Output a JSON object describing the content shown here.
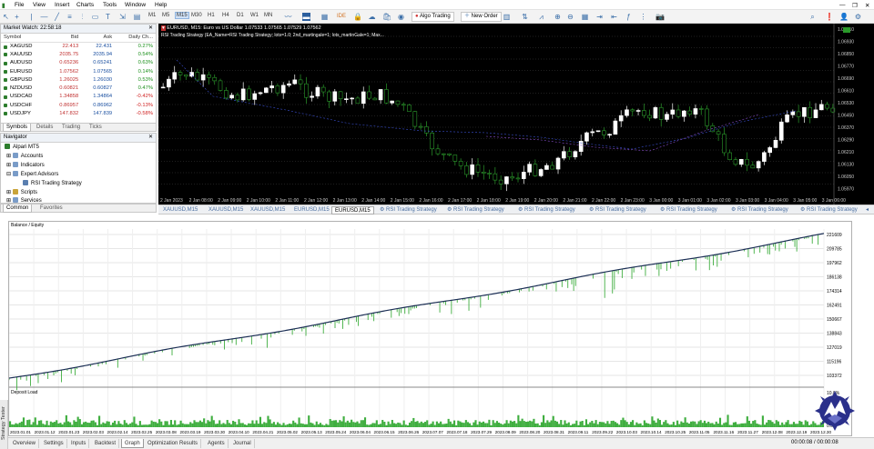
{
  "menu": [
    "File",
    "View",
    "Insert",
    "Charts",
    "Tools",
    "Window",
    "Help"
  ],
  "toolbar": {
    "timeframes": [
      "M1",
      "M5",
      "M15",
      "M30",
      "H1",
      "H4",
      "D1",
      "W1",
      "MN"
    ],
    "selected_tf": "M15",
    "algo_trading": "Algo Trading",
    "new_order": "New Order"
  },
  "market_watch": {
    "title": "Market Watch: 22:58:18",
    "columns": [
      "Symbol",
      "Bid",
      "Ask",
      "Daily Ch..."
    ],
    "rows": [
      {
        "symbol": "XAGUSD",
        "bid": "22.413",
        "ask": "22.431",
        "change": "0.27%"
      },
      {
        "symbol": "XAUUSD",
        "bid": "2035.75",
        "ask": "2035.94",
        "change": "0.54%"
      },
      {
        "symbol": "AUDUSD",
        "bid": "0.65236",
        "ask": "0.65241",
        "change": "0.63%"
      },
      {
        "symbol": "EURUSD",
        "bid": "1.07562",
        "ask": "1.07565",
        "change": "0.14%"
      },
      {
        "symbol": "GBPUSD",
        "bid": "1.26025",
        "ask": "1.26030",
        "change": "0.53%"
      },
      {
        "symbol": "NZDUSD",
        "bid": "0.60821",
        "ask": "0.60827",
        "change": "0.47%"
      },
      {
        "symbol": "USDCAD",
        "bid": "1.34858",
        "ask": "1.34864",
        "change": "-0.42%"
      },
      {
        "symbol": "USDCHF",
        "bid": "0.86957",
        "ask": "0.86962",
        "change": "-0.13%"
      },
      {
        "symbol": "USDJPY",
        "bid": "147.832",
        "ask": "147.839",
        "change": "-0.58%"
      }
    ],
    "tabs": [
      "Symbols",
      "Details",
      "Trading",
      "Ticks"
    ]
  },
  "navigator": {
    "title": "Navigator",
    "items": [
      "Alpari MT5",
      "Accounts",
      "Indicators",
      "Expert Advisors",
      "RSI Trading Strategy",
      "Scripts",
      "Services"
    ],
    "tabs": [
      "Common",
      "Favorites"
    ]
  },
  "chart": {
    "header": "EURUSD, M15:  Euro vs US Dollar  1.07533 1.07565 1.07529 1.07562",
    "ea_line": "RSI Trading Strategy (EA_Name=RSI Trading Strategy; lots=1.0; 2nd_martingale=1; lots_martinGale=1; Max...",
    "price_labels": [
      "1.07010",
      "1.06930",
      "1.06850",
      "1.06770",
      "1.06690",
      "1.06610",
      "1.06530",
      "1.06450",
      "1.06370",
      "1.06290",
      "1.06210",
      "1.06130",
      "1.06050",
      "1.05970"
    ],
    "time_labels": [
      "2 Jan 2023",
      "2 Jan 08:00",
      "2 Jan 09:00",
      "2 Jan 10:00",
      "2 Jan 11:00",
      "2 Jan 12:00",
      "2 Jan 13:00",
      "2 Jan 14:00",
      "2 Jan 15:00",
      "2 Jan 16:00",
      "2 Jan 17:00",
      "2 Jan 18:00",
      "2 Jan 19:00",
      "2 Jan 20:00",
      "2 Jan 21:00",
      "2 Jan 22:00",
      "2 Jan 23:00",
      "3 Jan 00:00",
      "3 Jan 01:00",
      "3 Jan 02:00",
      "3 Jan 03:00",
      "3 Jan 04:00",
      "3 Jan 05:00",
      "3 Jan 06:00"
    ],
    "tabs": [
      "XAUUSD,M15",
      "XAUUSD,M15",
      "XAUUSD,M15",
      "EURUSD,M15",
      "EURUSD,M15",
      "RSI Trading Strategy",
      "RSI Trading Strategy",
      "RSI Trading Strategy",
      "RSI Trading Strategy",
      "RSI Trading Strategy",
      "RSI Trading Strategy",
      "RSI Trading Strategy"
    ],
    "active_tab": 4
  },
  "tester": {
    "graph_title": "Balance / Equity",
    "deposit_title": "Deposit Load",
    "deposit_labels": [
      "10.0%",
      "0.0%"
    ],
    "y_labels": [
      "221609",
      "209785",
      "197962",
      "186138",
      "174314",
      "162491",
      "150667",
      "138843",
      "127019",
      "115196",
      "103372"
    ],
    "x_labels": [
      "2023.01.01",
      "2023.01.12",
      "2023.01.23",
      "2023.02.03",
      "2023.02.14",
      "2023.02.25",
      "2023.03.08",
      "2023.03.19",
      "2023.03.30",
      "2023.04.10",
      "2023.04.21",
      "2023.05.02",
      "2023.05.13",
      "2023.05.24",
      "2023.06.04",
      "2023.06.15",
      "2023.06.26",
      "2023.07.07",
      "2023.07.18",
      "2023.07.29",
      "2023.08.09",
      "2023.08.20",
      "2023.08.31",
      "2023.09.11",
      "2023.09.22",
      "2023.10.03",
      "2023.10.14",
      "2023.10.25",
      "2023.11.05",
      "2023.11.16",
      "2023.11.27",
      "2023.12.08",
      "2023.12.19",
      "2023.12.30"
    ],
    "tabs": [
      "Overview",
      "Settings",
      "Inputs",
      "Backtest",
      "Graph",
      "Optimization Results",
      "Agents",
      "Journal"
    ],
    "active_tab": "Graph",
    "timer": "00:00:08 / 00:00:08",
    "side_label": "Strategy Tester"
  },
  "colors": {
    "bull": "#ffffff",
    "bear": "#2b9a2b",
    "balance": "#1c2f55",
    "equity": "#3fae3f",
    "chart_bg": "#000000"
  }
}
